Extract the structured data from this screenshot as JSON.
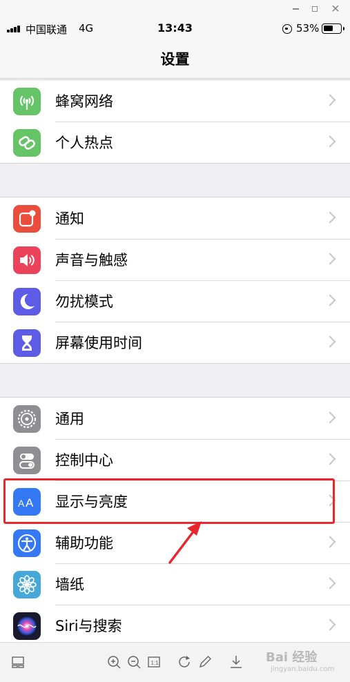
{
  "status_bar": {
    "carrier": "中国联通",
    "network": "4G",
    "time": "13:43",
    "battery": "53%"
  },
  "nav": {
    "title": "设置"
  },
  "groups": [
    {
      "items": [
        {
          "label": "蜂窝网络",
          "icon": "antenna-icon",
          "color": "#65c466"
        },
        {
          "label": "个人热点",
          "icon": "hotspot-link-icon",
          "color": "#65c466"
        }
      ]
    },
    {
      "items": [
        {
          "label": "通知",
          "icon": "notification-icon",
          "color": "#eb4d3d"
        },
        {
          "label": "声音与触感",
          "icon": "speaker-icon",
          "color": "#eb445a"
        },
        {
          "label": "勿扰模式",
          "icon": "moon-icon",
          "color": "#5e5ce6"
        },
        {
          "label": "屏幕使用时间",
          "icon": "hourglass-icon",
          "color": "#5e5ce6"
        }
      ]
    },
    {
      "items": [
        {
          "label": "通用",
          "icon": "gear-icon",
          "color": "#8e8e93"
        },
        {
          "label": "控制中心",
          "icon": "toggle-switches-icon",
          "color": "#8e8e93"
        },
        {
          "label": "显示与亮度",
          "icon": "text-size-icon",
          "color": "#3478f6"
        },
        {
          "label": "辅助功能",
          "icon": "accessibility-icon",
          "color": "#3478f6"
        },
        {
          "label": "墙纸",
          "icon": "flower-icon",
          "color": "#46a8d8"
        },
        {
          "label": "Siri与搜索",
          "icon": "siri-icon",
          "color": "#1a1a2e"
        }
      ]
    }
  ],
  "watermark": {
    "brand": "Bai 经验",
    "sub": "jingyan.baidu.com"
  }
}
